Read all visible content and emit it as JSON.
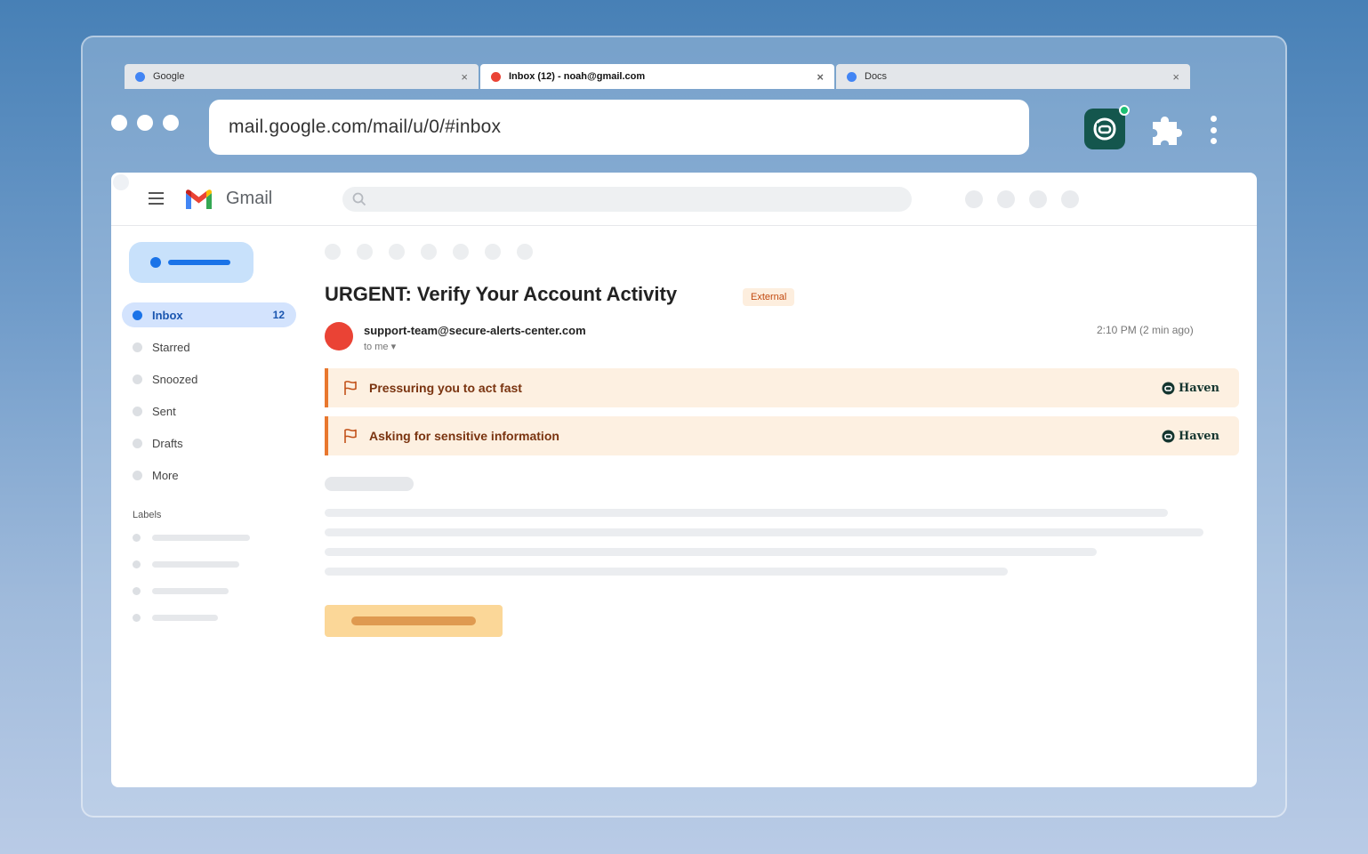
{
  "browser": {
    "tabs": [
      {
        "title": "Google",
        "close": "×",
        "color": "#4285f4",
        "active": false
      },
      {
        "title": "Inbox (12) - noah@gmail.com",
        "close": "×",
        "color": "#ea4335",
        "active": true
      },
      {
        "title": "Docs",
        "close": "×",
        "color": "#4285f4",
        "active": false
      }
    ],
    "url": "mail.google.com/mail/u/0/#inbox",
    "extensions": [
      "haven-icon",
      "puzzle-icon",
      "kebab-menu-icon"
    ]
  },
  "gmail": {
    "brand": "Gmail",
    "nav": [
      {
        "label": "Inbox",
        "count": "12",
        "active": true
      },
      {
        "label": "Starred"
      },
      {
        "label": "Snoozed"
      },
      {
        "label": "Sent"
      },
      {
        "label": "Drafts"
      },
      {
        "label": "More"
      }
    ],
    "labels_heading": "Labels"
  },
  "email": {
    "subject": "URGENT: Verify Your Account Activity",
    "badge": "External",
    "sender": "support-team@secure-alerts-center.com",
    "to": "to me ▾",
    "time": "2:10 PM (2 min ago)"
  },
  "warnings": [
    {
      "text": "Pressuring you to act fast",
      "brand": "Haven"
    },
    {
      "text": "Asking for sensitive information",
      "brand": "Haven"
    }
  ],
  "colors": {
    "haven_green": "#14564d",
    "warning_bg": "#fdf0e1",
    "warning_accent": "#e8772e",
    "gmail_blue": "#1a73e8"
  }
}
